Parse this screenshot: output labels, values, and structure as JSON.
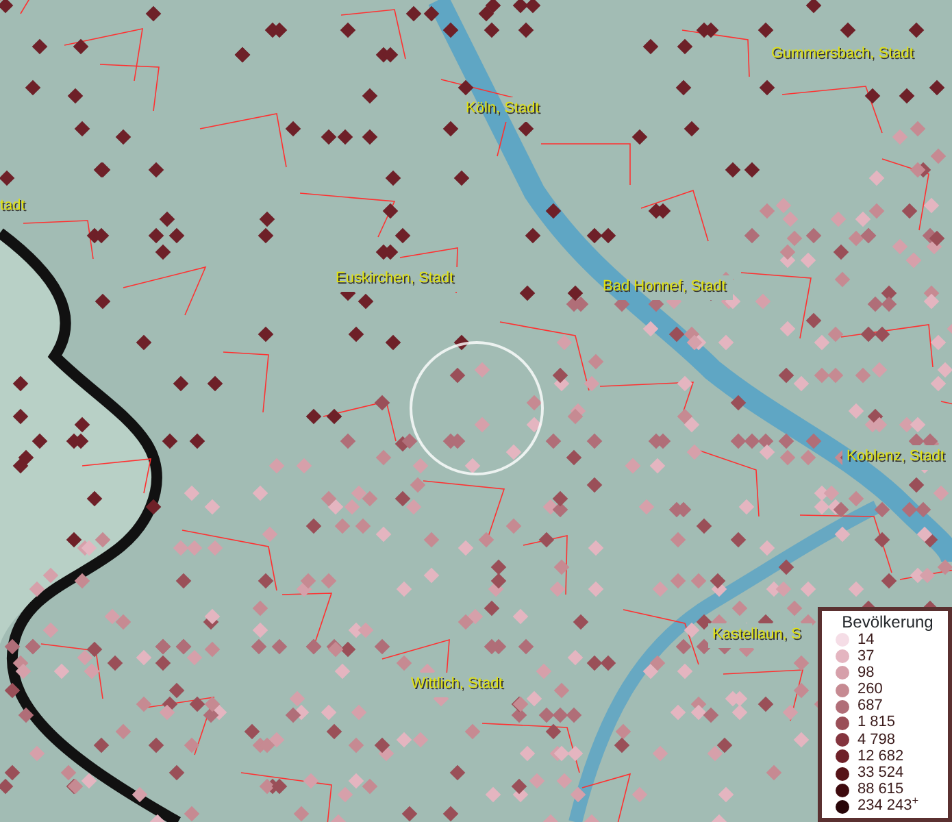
{
  "map": {
    "labels": [
      {
        "text": "Gummersbach, Stadt"
      },
      {
        "text": "Köln, Stadt"
      },
      {
        "text": "tadt"
      },
      {
        "text": "Euskirchen, Stadt"
      },
      {
        "text": "Bad Honnef, Stadt"
      },
      {
        "text": "Koblenz, Stadt"
      },
      {
        "text": "Kastellaun, S"
      },
      {
        "text": "Wittlich, Stadt"
      }
    ]
  },
  "legend": {
    "title": "Bevölkerung",
    "items": [
      {
        "label": "14",
        "color": "#f5dde6"
      },
      {
        "label": "37",
        "color": "#e4b5c0"
      },
      {
        "label": "98",
        "color": "#d6a0aa"
      },
      {
        "label": "260",
        "color": "#c68a92"
      },
      {
        "label": "687",
        "color": "#b06e78"
      },
      {
        "label": "1 815",
        "color": "#9a4f58"
      },
      {
        "label": "4 798",
        "color": "#84343e"
      },
      {
        "label": "12 682",
        "color": "#6e2028"
      },
      {
        "label": "33 524",
        "color": "#561418"
      },
      {
        "label": "88 615",
        "color": "#3e0a0e"
      },
      {
        "label": "234 243$^{+}$",
        "color": "#280508"
      }
    ]
  }
}
